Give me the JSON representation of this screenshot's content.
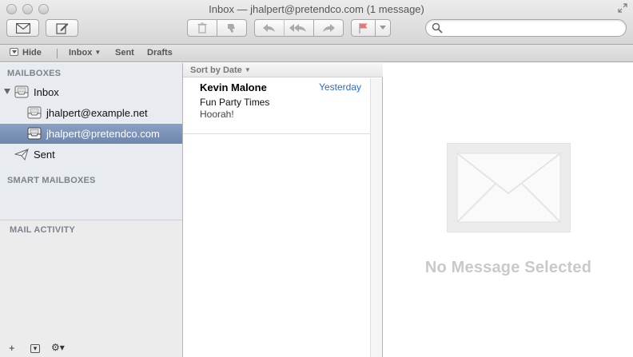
{
  "window": {
    "title": "Inbox — jhalpert@pretendco.com (1 message)"
  },
  "toolbar": {
    "get_mail": "envelope-icon",
    "compose": "compose-icon",
    "delete": "trash-icon",
    "junk": "thumbs-down-icon",
    "reply": "reply-icon",
    "reply_all": "reply-all-icon",
    "forward": "forward-icon",
    "flag": "flag-icon",
    "flag_color": "#d9534f",
    "search_placeholder": ""
  },
  "favorites": {
    "hide": "Hide",
    "inbox": "Inbox",
    "sent": "Sent",
    "drafts": "Drafts"
  },
  "sidebar": {
    "mailboxes_header": "MAILBOXES",
    "inbox": "Inbox",
    "accounts": [
      {
        "label": "jhalpert@example.net",
        "selected": false
      },
      {
        "label": "jhalpert@pretendco.com",
        "selected": true
      }
    ],
    "sent": "Sent",
    "smart_header": "SMART MAILBOXES",
    "activity_header": "MAIL ACTIVITY",
    "bottom": {
      "add": "+",
      "show": "▾",
      "action": "⚙▾"
    }
  },
  "message_list": {
    "sort_label": "Sort by Date",
    "messages": [
      {
        "from": "Kevin Malone",
        "date": "Yesterday",
        "subject": "Fun Party Times",
        "preview": "Hoorah!"
      }
    ]
  },
  "viewer": {
    "empty_text": "No Message Selected"
  },
  "colors": {
    "selection": "#7b91b8",
    "date_link": "#2a6ad8",
    "sidebar_bg": "#e8ebef"
  }
}
